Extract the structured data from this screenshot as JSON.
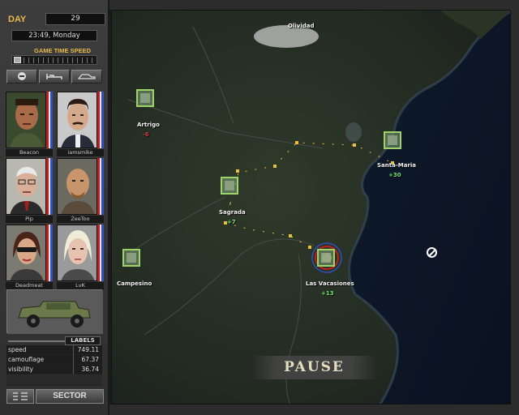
{
  "header": {
    "day_label": "DAY",
    "day_value": "29",
    "time": "23:49, Monday",
    "speed_label": "GAME TIME SPEED"
  },
  "toolbar": {
    "stop_icon": "minus-circle-icon",
    "sleep_icon": "bed-icon",
    "vehicle_icon": "vehicle-icon"
  },
  "mercs": [
    {
      "name": "Beacon"
    },
    {
      "name": "iamsmike"
    },
    {
      "name": "Pip"
    },
    {
      "name": "ZeeToo"
    },
    {
      "name": "Deadmeat"
    },
    {
      "name": "LvK"
    }
  ],
  "stats": {
    "labels_button": "LABELS",
    "rows": [
      {
        "label": "speed",
        "value": "749.11"
      },
      {
        "label": "camouflage",
        "value": "67.37"
      },
      {
        "label": "visibility",
        "value": "36.74"
      }
    ]
  },
  "bottom": {
    "sector_button": "SECTOR"
  },
  "map": {
    "towns": [
      {
        "name": "Olividad"
      },
      {
        "name": "Artrigo",
        "value": "-6",
        "color": "#d04040"
      },
      {
        "name": "Santa-Maria",
        "value": "+30",
        "color": "#6ee06e"
      },
      {
        "name": "Sagrada",
        "value": "+7",
        "color": "#6ee06e"
      },
      {
        "name": "Campesino"
      },
      {
        "name": "Las Vacasiones",
        "value": "+13",
        "color": "#6ee06e"
      }
    ],
    "pause_text": "PAUSE"
  },
  "colors": {
    "accent": "#e8b84a",
    "route": "#e8c040",
    "sector_border": "#9ed36a"
  }
}
